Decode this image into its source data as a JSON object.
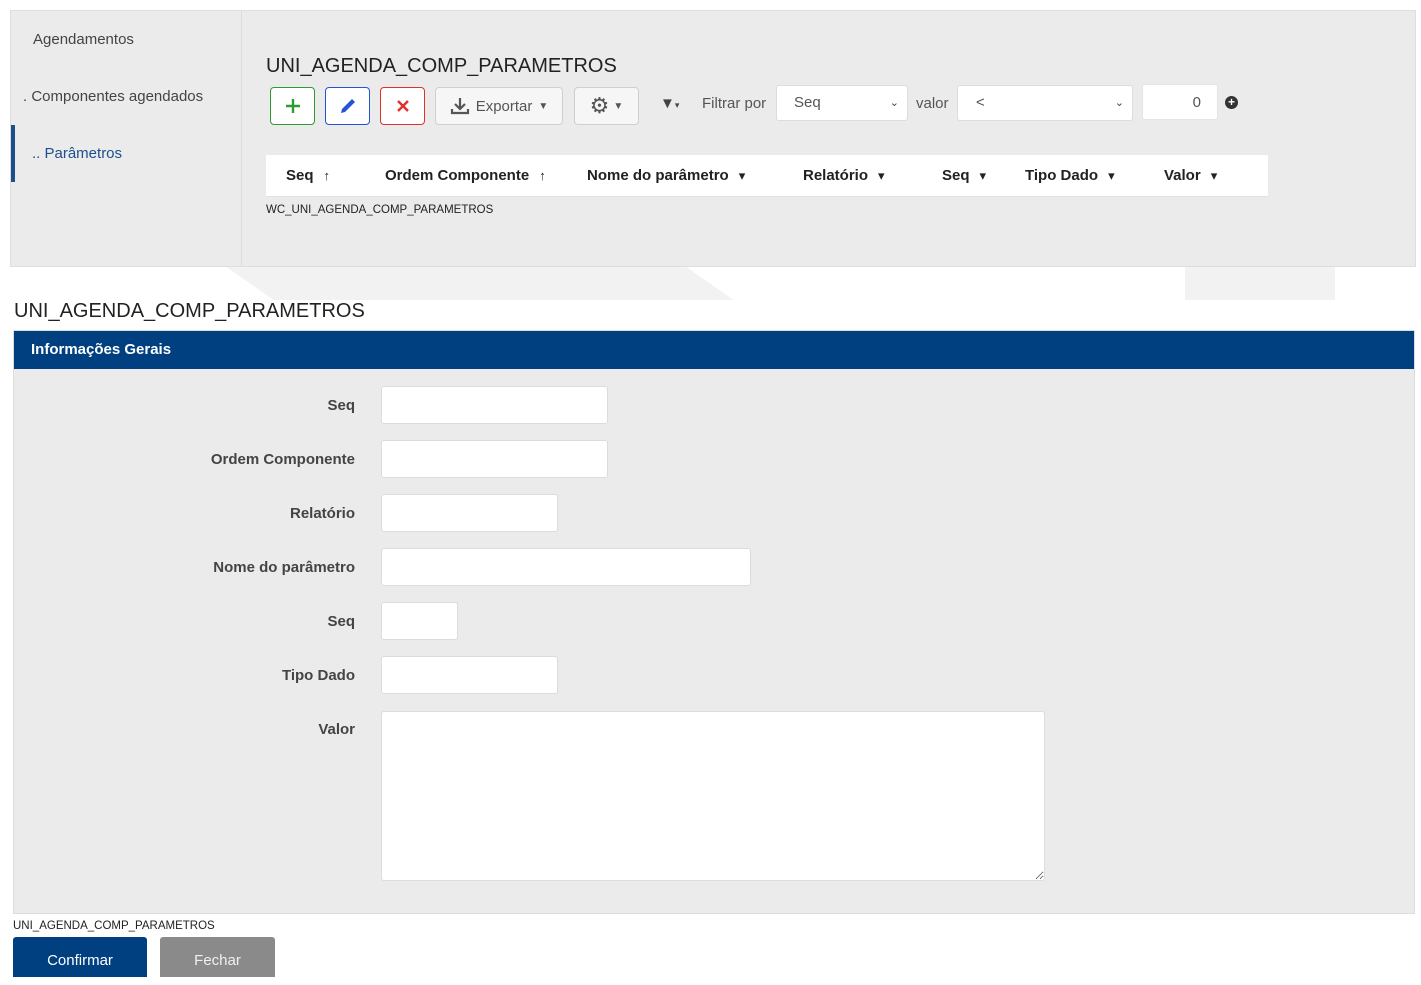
{
  "sidebar": {
    "items": [
      {
        "label": "Agendamentos"
      },
      {
        "label": ". Componentes agendados"
      },
      {
        "label": ".. Parâmetros"
      }
    ]
  },
  "grid": {
    "title": "UNI_AGENDA_COMP_PARAMETROS",
    "toolbar": {
      "add_icon": "plus-icon",
      "edit_icon": "pencil-icon",
      "delete_icon": "x-icon",
      "export_label": "Exportar",
      "filter_label": "Filtrar por",
      "filter_field": "Seq",
      "value_label": "valor",
      "operator": "<",
      "value": "0"
    },
    "columns": [
      {
        "label": "Seq",
        "sort": "↑"
      },
      {
        "label": "Ordem Componente",
        "sort": "↑"
      },
      {
        "label": "Nome do parâmetro",
        "sort": "▾"
      },
      {
        "label": "Relatório",
        "sort": "▾"
      },
      {
        "label": "Seq",
        "sort": "▾"
      },
      {
        "label": "Tipo Dado",
        "sort": "▾"
      },
      {
        "label": "Valor",
        "sort": "▾"
      }
    ],
    "footer": "WC_UNI_AGENDA_COMP_PARAMETROS"
  },
  "form": {
    "title": "UNI_AGENDA_COMP_PARAMETROS",
    "section_title": "Informações Gerais",
    "fields": [
      {
        "label": "Seq",
        "value": ""
      },
      {
        "label": "Ordem Componente",
        "value": ""
      },
      {
        "label": "Relatório",
        "value": ""
      },
      {
        "label": "Nome do parâmetro",
        "value": ""
      },
      {
        "label": "Seq",
        "value": ""
      },
      {
        "label": "Tipo Dado",
        "value": ""
      },
      {
        "label": "Valor",
        "value": ""
      }
    ],
    "footer": "UNI_AGENDA_COMP_PARAMETROS",
    "confirm_label": "Confirmar",
    "close_label": "Fechar"
  },
  "colors": {
    "primary": "#004080",
    "add": "#2f9a2f",
    "edit": "#2454d6",
    "delete": "#e0302a",
    "panel_bg": "#ebebeb"
  }
}
